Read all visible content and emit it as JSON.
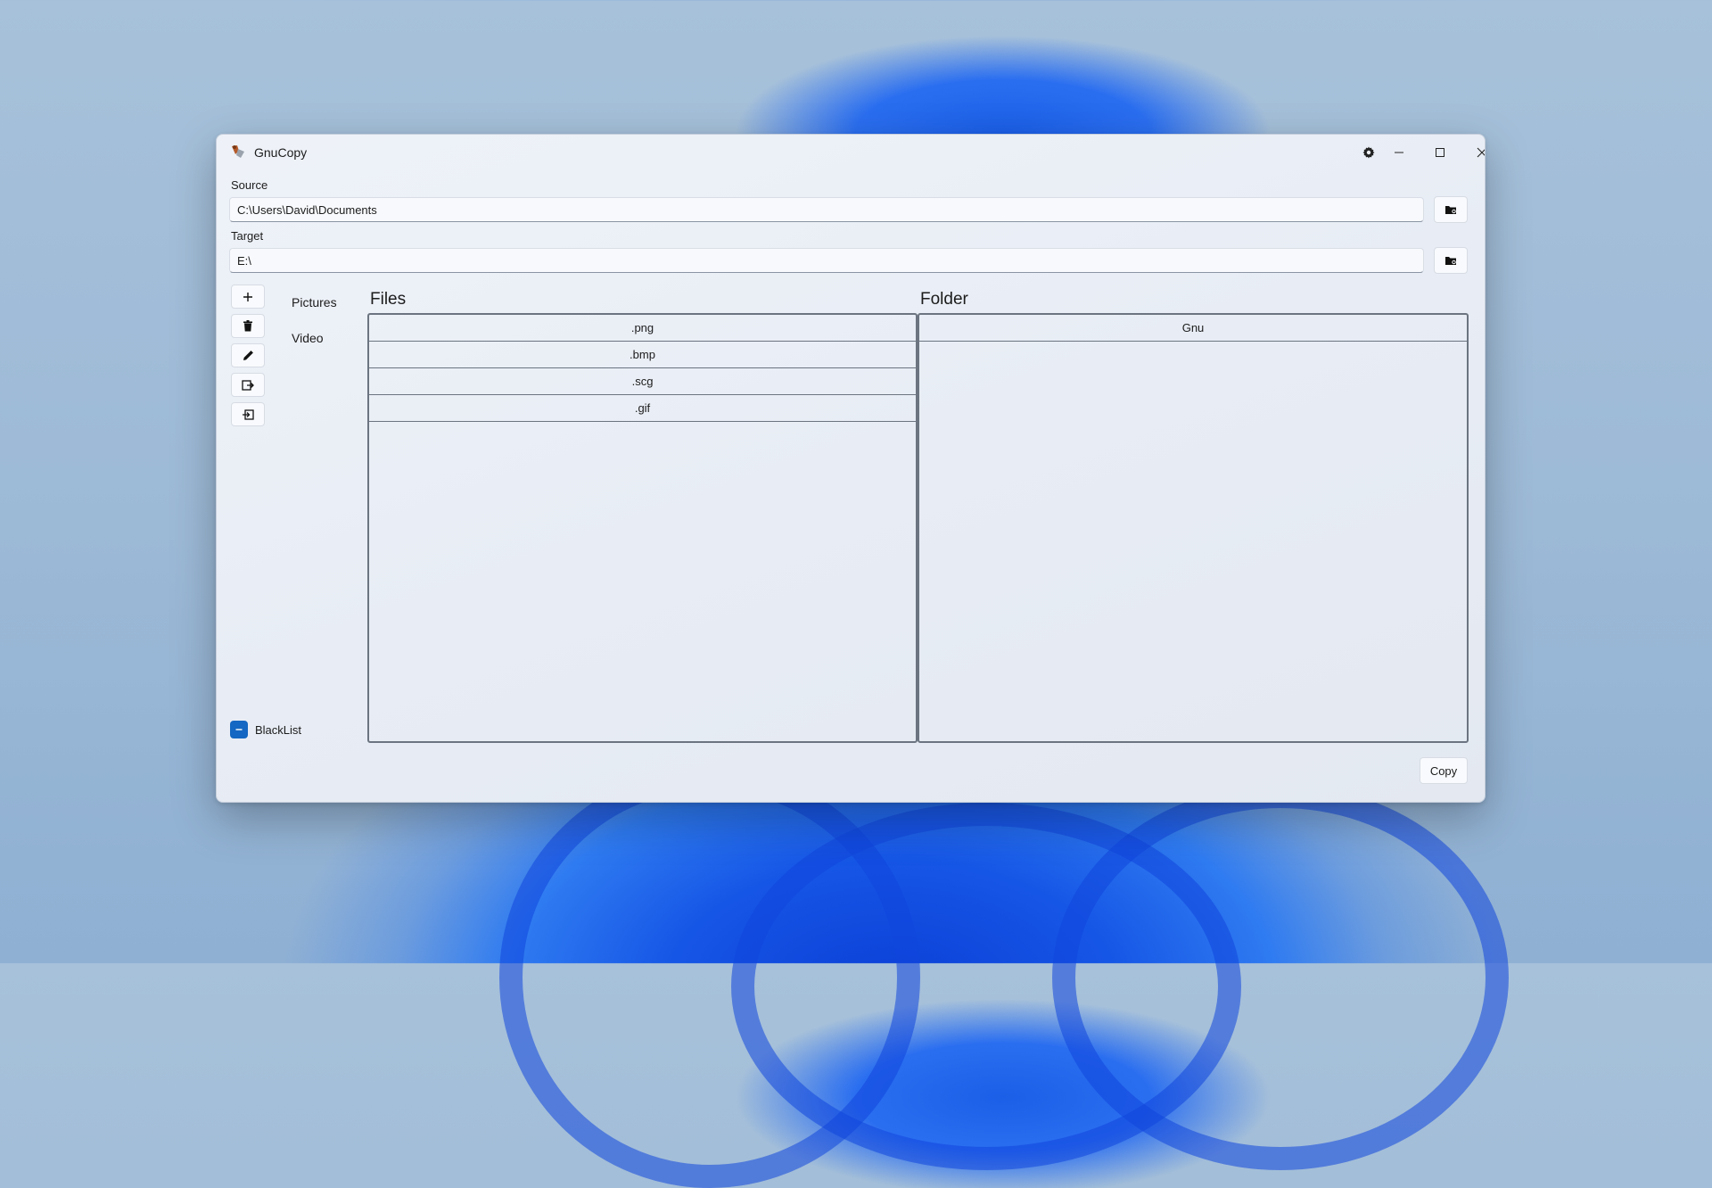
{
  "window": {
    "title": "GnuCopy",
    "controls": [
      "gear-icon",
      "minimize-icon",
      "maximize-icon",
      "close-icon"
    ]
  },
  "source": {
    "label": "Source",
    "value": "C:\\Users\\David\\Documents"
  },
  "target": {
    "label": "Target",
    "value": "E:\\"
  },
  "toolbar": {
    "icons": [
      "plus-icon",
      "trash-icon",
      "pencil-icon",
      "export-icon",
      "import-icon"
    ]
  },
  "categories": [
    "Pictures",
    "Video"
  ],
  "files": {
    "title": "Files",
    "items": [
      ".png",
      ".bmp",
      ".scg",
      ".gif"
    ]
  },
  "folder": {
    "title": "Folder",
    "items": [
      "Gnu"
    ]
  },
  "blacklist": {
    "label": "BlackList",
    "state": "indeterminate"
  },
  "copy_button": "Copy",
  "colors": {
    "accent": "#1467c2",
    "grid_border": "#6b7480"
  }
}
